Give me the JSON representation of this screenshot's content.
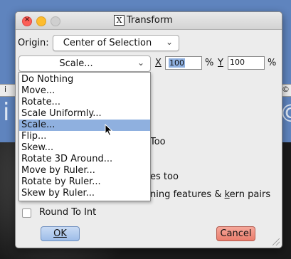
{
  "dialog": {
    "title": "Transform",
    "title_icon": "X",
    "origin_label": "Origin:",
    "origin_value": "Center of Selection",
    "transform_select_value": "Scale...",
    "x_label": "X",
    "x_value": "100",
    "x_unit": "%",
    "y_label": "Y",
    "y_value": "100",
    "y_unit": "%",
    "partial_too": "Too",
    "partial_es_too": "es too",
    "partial_kern": "ning features & kern pairs",
    "partial_kern_underline": "k",
    "round_label": "Round To Int",
    "ok_label": "OK",
    "cancel_label": "Cancel"
  },
  "menu": {
    "items": [
      "Do Nothing",
      "Move...",
      "Rotate...",
      "Scale Uniformly...",
      "Scale...",
      "Flip...",
      "Skew...",
      "Rotate 3D Around...",
      "Move by Ruler...",
      "Rotate by Ruler...",
      "Skew by Ruler..."
    ],
    "highlighted_index": 4
  },
  "colors": {
    "highlight": "#8fb0df",
    "ok_button": "#9dbde8",
    "cancel_button": "#ea7d6c",
    "background_app": "#5f84be"
  }
}
